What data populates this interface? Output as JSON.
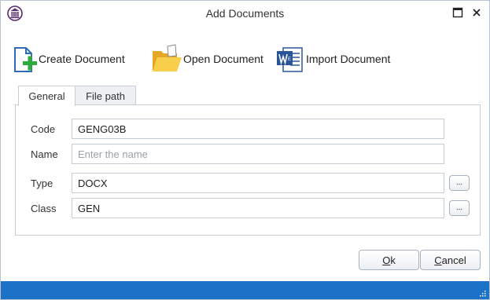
{
  "window": {
    "title": "Add Documents"
  },
  "toolbar": {
    "create_label": "Create Document",
    "open_label": "Open Document",
    "import_label": "Import Document"
  },
  "tabs": [
    {
      "label": "General",
      "active": true
    },
    {
      "label": "File path",
      "active": false
    }
  ],
  "form": {
    "code": {
      "label": "Code",
      "value": "GENG03B"
    },
    "name": {
      "label": "Name",
      "value": "",
      "placeholder": "Enter the name"
    },
    "type": {
      "label": "Type",
      "value": "DOCX",
      "button": "..."
    },
    "class": {
      "label": "Class",
      "value": "GEN",
      "button": "..."
    }
  },
  "buttons": {
    "ok_mnemonic": "O",
    "ok_rest": "k",
    "cancel_mnemonic": "C",
    "cancel_rest": "ancel"
  },
  "icons": {
    "app": "building-columns-icon",
    "maximize": "maximize-icon",
    "close": "close-icon",
    "create": "new-document-plus-icon",
    "open": "open-folder-icon",
    "import": "word-document-icon",
    "grip": "resize-grip-icon"
  },
  "colors": {
    "statusbar": "#1b72c6",
    "accent_green": "#2eab3a",
    "folder_yellow": "#f2c33a",
    "word_blue": "#2a5699"
  }
}
